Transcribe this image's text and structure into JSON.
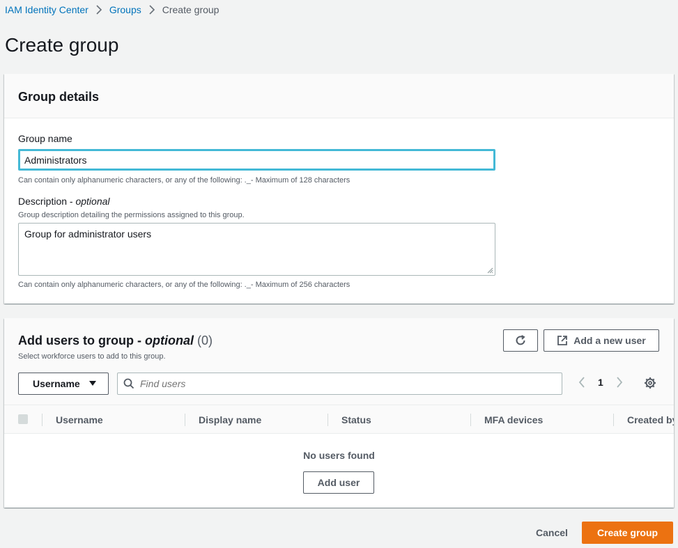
{
  "breadcrumb": {
    "items": [
      "IAM Identity Center",
      "Groups"
    ],
    "current": "Create group"
  },
  "page": {
    "title": "Create group"
  },
  "group_details": {
    "title": "Group details",
    "name_label": "Group name",
    "name_value": "Administrators",
    "name_hint": "Can contain only alphanumeric characters, or any of the following: ._- Maximum of 128 characters",
    "description_label": "Description - ",
    "description_optional": "optional",
    "description_subhint": "Group description detailing the permissions assigned to this group.",
    "description_value": "Group for administrator users",
    "description_hint": "Can contain only alphanumeric characters, or any of the following: ._- Maximum of 256 characters"
  },
  "add_users": {
    "title": "Add users to group - ",
    "title_optional": "optional",
    "count": "(0)",
    "subtitle": "Select workforce users to add to this group.",
    "refresh_icon": "refresh-icon",
    "add_new_user_label": "Add a new user",
    "filter_property": "Username",
    "search_placeholder": "Find users",
    "page_number": "1",
    "columns": [
      "Username",
      "Display name",
      "Status",
      "MFA devices",
      "Created by"
    ],
    "empty_message": "No users found",
    "add_user_label": "Add user"
  },
  "footer": {
    "cancel_label": "Cancel",
    "create_label": "Create group"
  },
  "colors": {
    "link": "#0073bb",
    "primary": "#ec7211",
    "focus": "#44b9d6"
  }
}
